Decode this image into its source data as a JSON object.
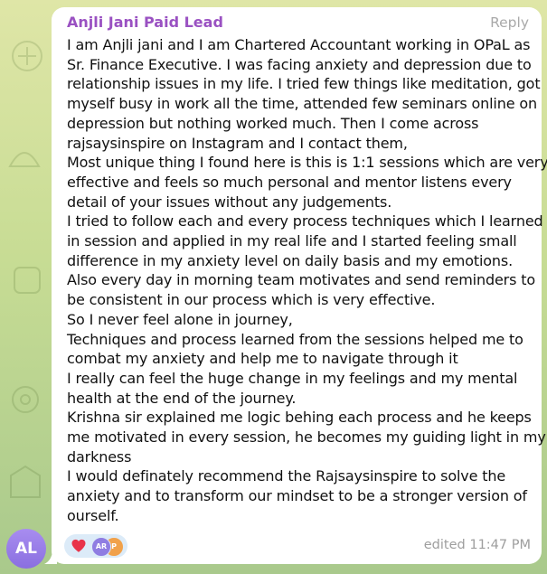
{
  "message": {
    "sender": "Anjli Jani Paid Lead",
    "reply_label": "Reply",
    "lines": [
      "I am Anjli jani and I am Chartered Accountant working in OPaL as",
      "Sr. Finance Executive. I was facing anxiety and depression due to",
      "relationship issues in my life. I tried few things like meditation, got",
      "myself busy in work all the time, attended few seminars online on",
      "depression but nothing worked much. Then I come across",
      "rajsaysinspire on Instagram and I contact them,",
      "Most unique thing I found here is this is 1:1 sessions which are very",
      "effective and feels so much personal and mentor listens every",
      "detail of your issues without any judgements.",
      "I tried to follow each and every process techniques which I learned",
      "in session and applied in my real life and I started feeling small",
      "difference in my anxiety level on daily basis and my emotions.",
      "Also every day in morning team motivates and send reminders to",
      "be consistent in our process which is very effective.",
      "So I never feel alone in journey,",
      "Techniques and process learned from the sessions helped me to",
      "combat my anxiety and help me to navigate through it",
      "I really can feel the huge change in my feelings and my mental",
      "health at the end of the journey.",
      "Krishna sir explained me logic behing each process and he keeps",
      "me motivated in every session, he becomes my guiding light in my",
      "darkness",
      "I would definately recommend the Rajsaysinspire to solve the",
      "anxiety and to transform our mindset to be a stronger version of",
      "ourself."
    ],
    "edited_label": "edited",
    "time": "11:47 PM",
    "reactions": {
      "emoji_icon": "heart-icon",
      "avatars": [
        "AR",
        "P"
      ]
    }
  },
  "sender_avatar": {
    "initials": "AL"
  },
  "colors": {
    "sender_name": "#9a51c2",
    "bubble": "#ffffff",
    "avatar": "#8f76e6",
    "reaction_bg": "#dcebf8",
    "heart": "#e8334a"
  }
}
